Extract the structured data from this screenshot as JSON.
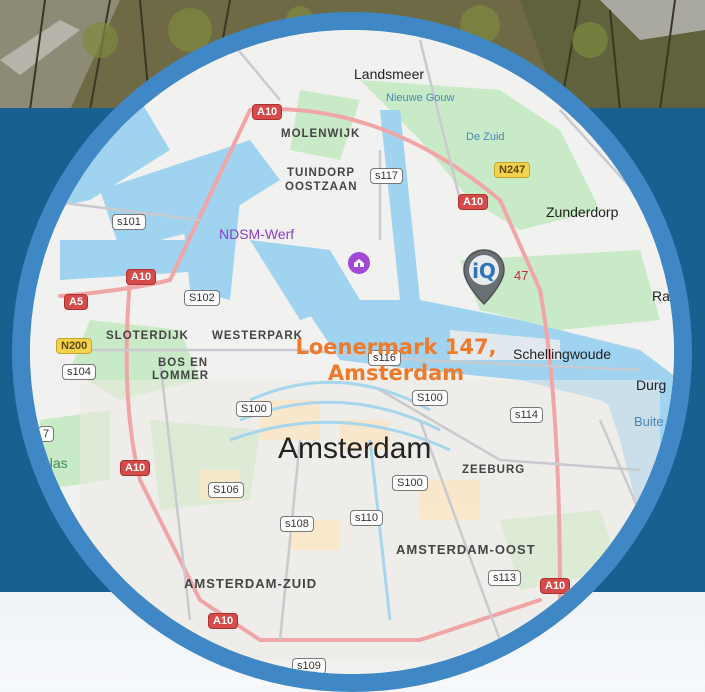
{
  "map": {
    "places": {
      "landsmeer": "Landsmeer",
      "zunderdorp": "Zunderdorp",
      "schellingwoude": "Schellingwoude",
      "amsterdam": "Amsterdam",
      "ra": "Ra",
      "durg": "Durg",
      "ndsm": "NDSM-Werf"
    },
    "water": {
      "nieuwe_gouw": "Nieuwe Gouw",
      "de_zuid": "De Zuid",
      "buite": "Buite",
      "plas": "plas"
    },
    "districts": {
      "molenwijk": "MOLENWIJK",
      "tuindorp1": "TUINDORP",
      "tuindorp2": "OOSTZAAN",
      "sloterdijk": "SLOTERDIJK",
      "westerpark": "WESTERPARK",
      "bos1": "BOS EN",
      "bos2": "LOMMER",
      "zeeburg": "ZEEBURG",
      "oost": "AMSTERDAM-OOST",
      "zuid": "AMSTERDAM-ZUID"
    },
    "shields": {
      "a10_1": "A10",
      "a10_2": "A10",
      "a10_3": "A10",
      "a10_4": "A10",
      "a10_5": "A10",
      "a10_6": "A10",
      "a5": "A5",
      "n200": "N200",
      "n247": "N247",
      "s117": "s117",
      "s101": "s101",
      "s102": "S102",
      "s104": "s104",
      "s116": "s116",
      "s100_1": "S100",
      "s100_2": "S100",
      "s100_3": "S100",
      "s114": "s114",
      "s106": "S106",
      "s108": "s108",
      "s110": "s110",
      "s113": "s113",
      "s109": "s109",
      "seven": "7"
    },
    "marker_number": "47",
    "address": "Loenermark 147, Amsterdam"
  },
  "colors": {
    "band": "#17608f",
    "ring": "#3f88c5",
    "water": "#9fd3ef",
    "park": "#c8eac6",
    "highway": "#f4a8a8",
    "address": "#ef7a2b",
    "marker": "#6a6f74"
  }
}
